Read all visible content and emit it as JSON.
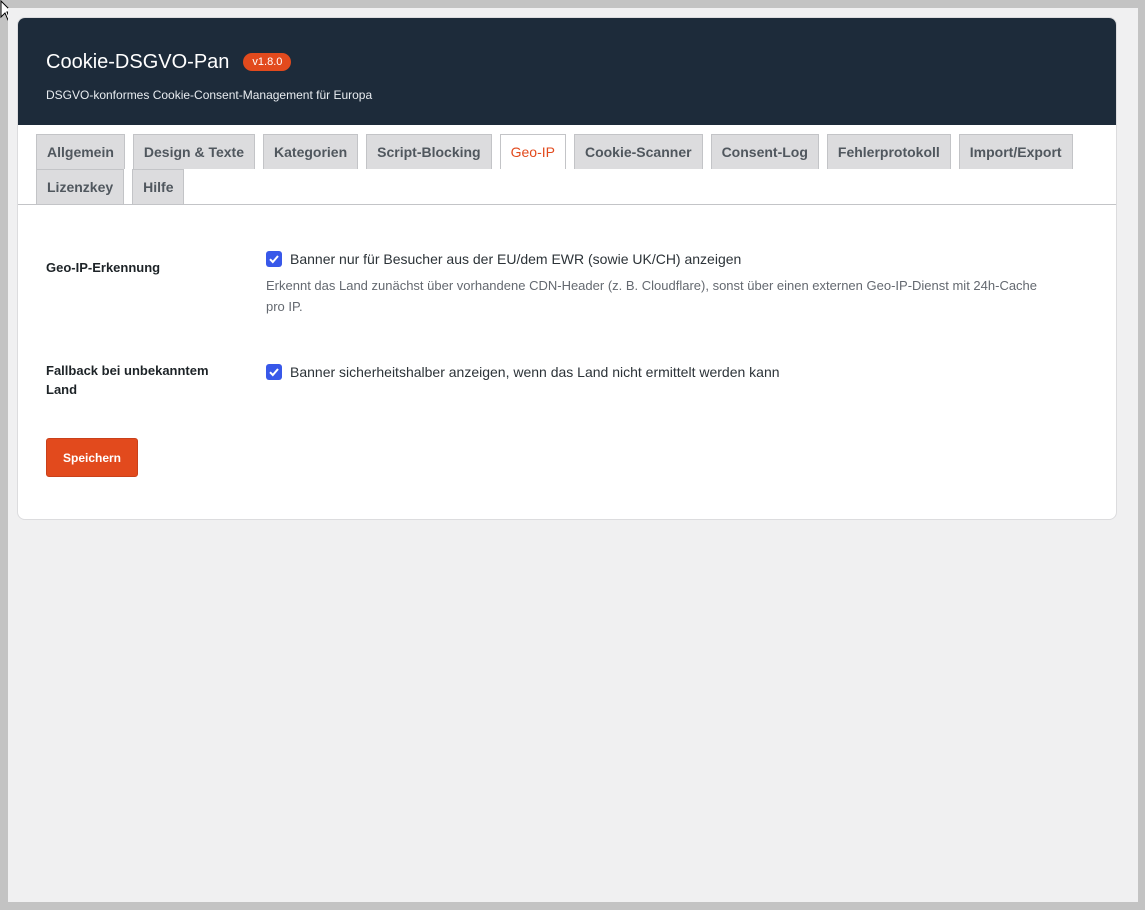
{
  "header": {
    "title": "Cookie-DSGVO-Pan",
    "version": "v1.8.0",
    "subtitle": "DSGVO-konformes Cookie-Consent-Management für Europa"
  },
  "tabs": [
    {
      "label": "Allgemein"
    },
    {
      "label": "Design & Texte"
    },
    {
      "label": "Kategorien"
    },
    {
      "label": "Script-Blocking"
    },
    {
      "label": "Geo-IP",
      "active": true
    },
    {
      "label": "Cookie-Scanner"
    },
    {
      "label": "Consent-Log"
    },
    {
      "label": "Fehlerprotokoll"
    },
    {
      "label": "Import/Export"
    },
    {
      "label": "Lizenzkey"
    },
    {
      "label": "Hilfe"
    }
  ],
  "settings": {
    "geoip": {
      "label": "Geo-IP-Erkennung",
      "checkbox_label": "Banner nur für Besucher aus der EU/dem EWR (sowie UK/CH) anzeigen",
      "checked": true,
      "description": "Erkennt das Land zunächst über vorhandene CDN-Header (z. B. Cloudflare), sonst über einen externen Geo-IP-Dienst mit 24h-Cache pro IP."
    },
    "fallback": {
      "label": "Fallback bei unbekanntem Land",
      "checkbox_label": "Banner sicherheitshalber anzeigen, wenn das Land nicht ermittelt werden kann",
      "checked": true
    }
  },
  "actions": {
    "save_label": "Speichern"
  },
  "colors": {
    "header_bg": "#1d2b3a",
    "accent": "#e24a1d",
    "checkbox": "#3858e9"
  }
}
